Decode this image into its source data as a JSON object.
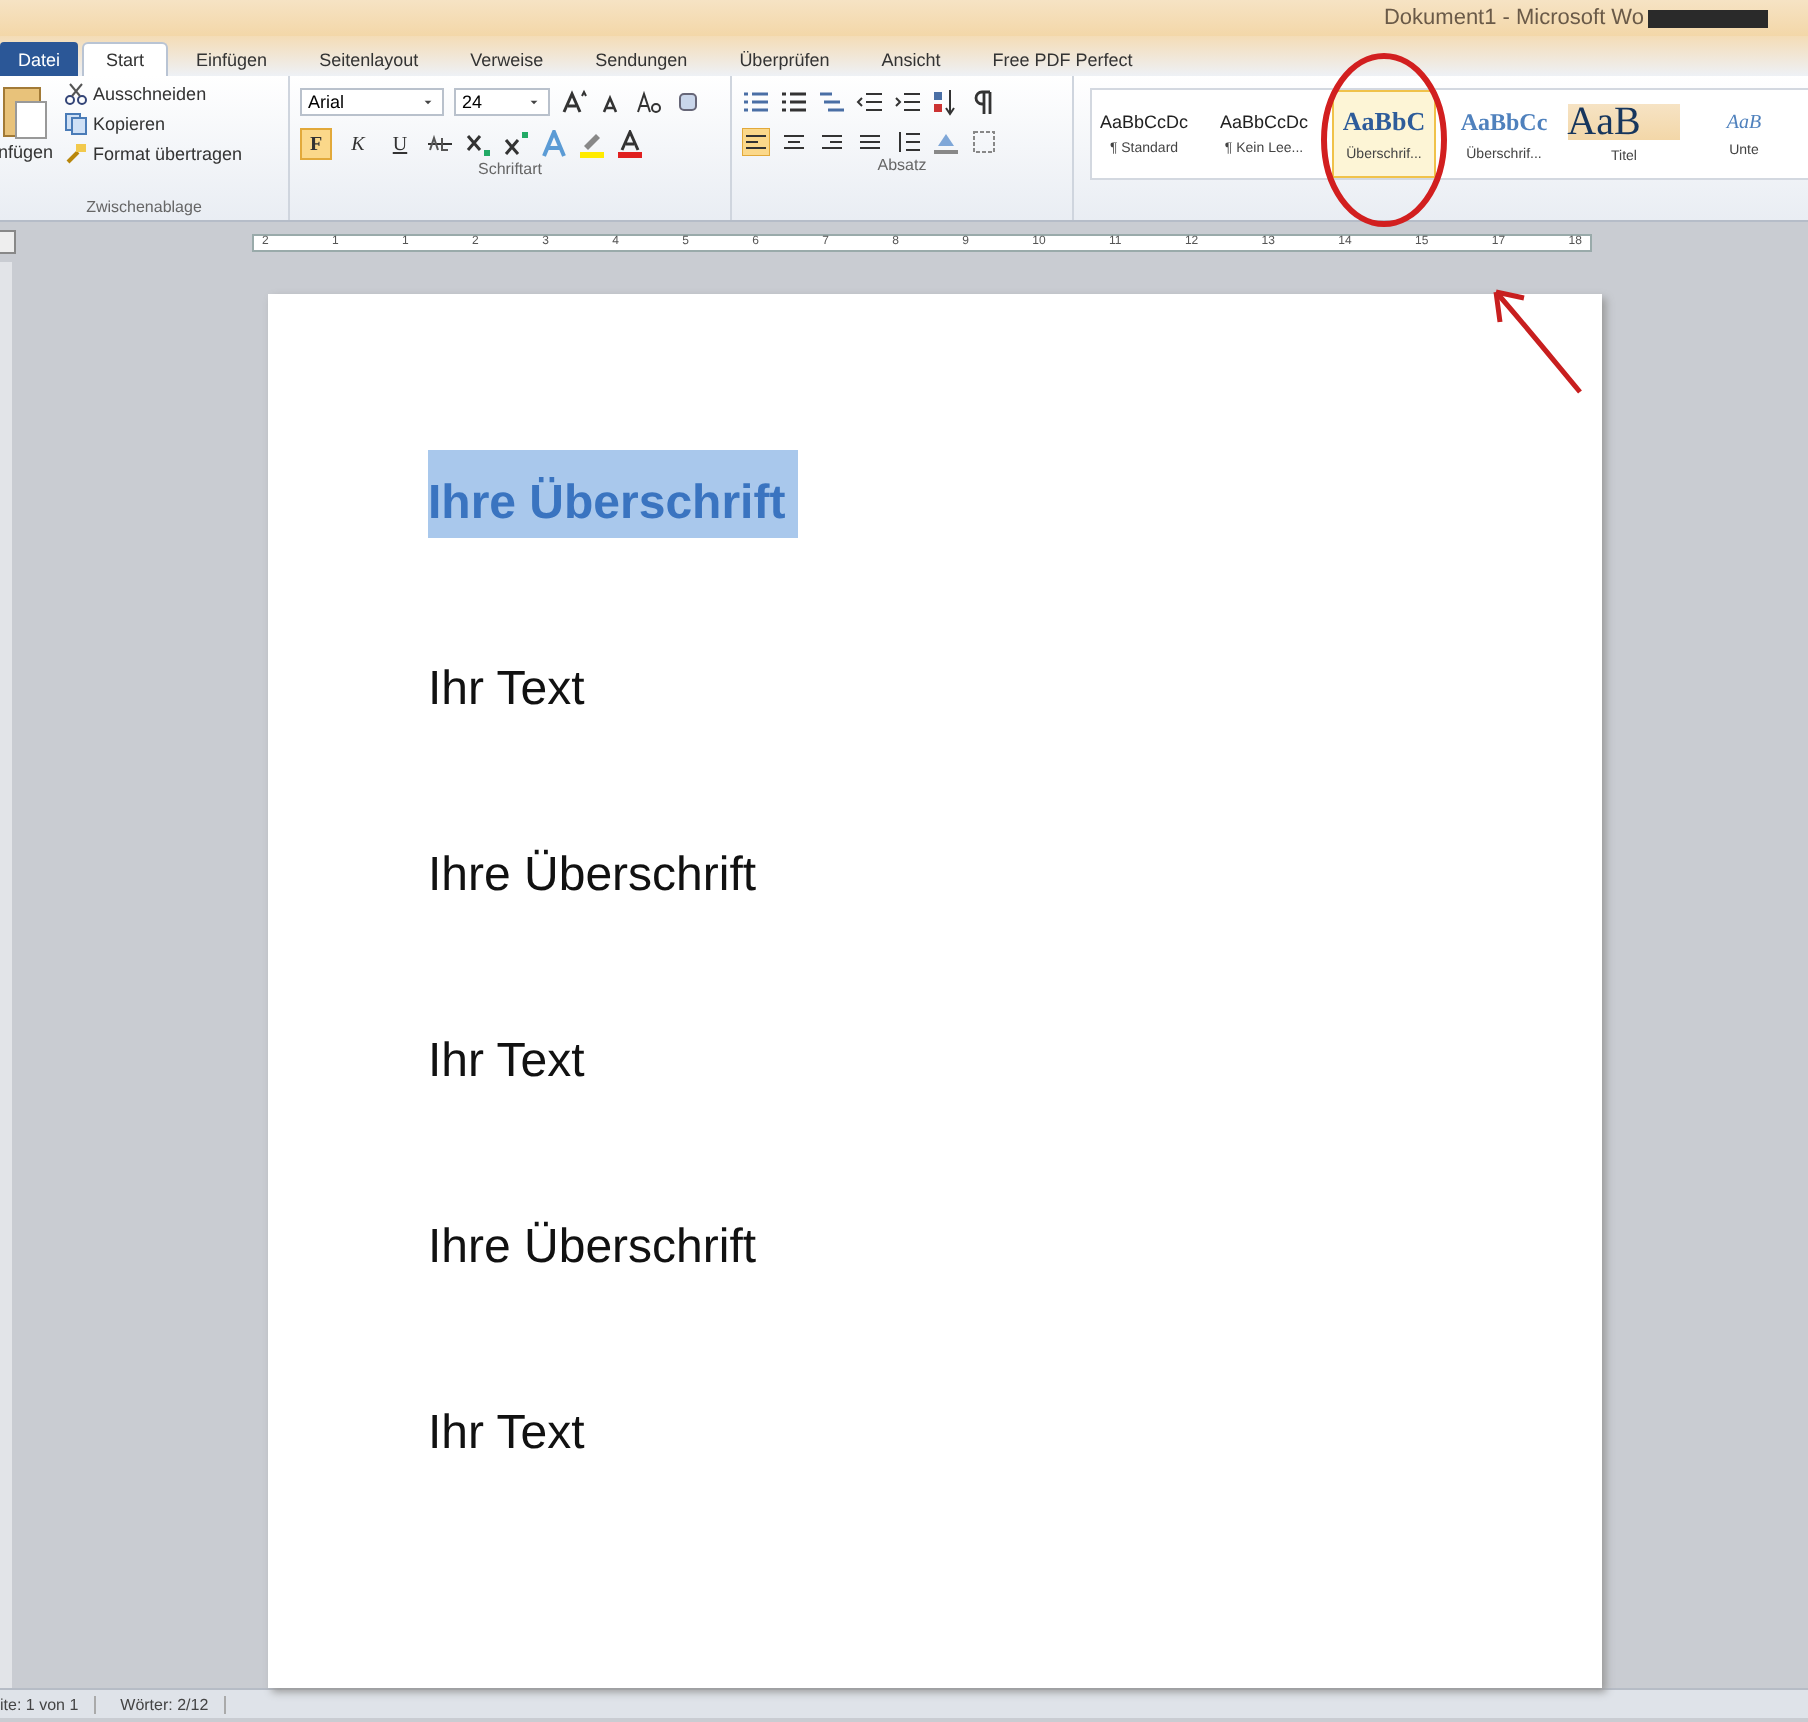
{
  "window": {
    "title": "Dokument1 - Microsoft Wo"
  },
  "tabs": [
    {
      "label": "Datei",
      "kind": "file",
      "selected": false
    },
    {
      "label": "Start",
      "kind": "tab",
      "selected": true
    },
    {
      "label": "Einfügen",
      "kind": "tab",
      "selected": false
    },
    {
      "label": "Seitenlayout",
      "kind": "tab",
      "selected": false
    },
    {
      "label": "Verweise",
      "kind": "tab",
      "selected": false
    },
    {
      "label": "Sendungen",
      "kind": "tab",
      "selected": false
    },
    {
      "label": "Überprüfen",
      "kind": "tab",
      "selected": false
    },
    {
      "label": "Ansicht",
      "kind": "tab",
      "selected": false
    },
    {
      "label": "Free PDF Perfect",
      "kind": "tab",
      "selected": false
    }
  ],
  "clipboard": {
    "paste_label": "nfügen",
    "items": [
      "Ausschneiden",
      "Kopieren",
      "Format übertragen"
    ],
    "group_label": "Zwischenablage"
  },
  "font": {
    "name": "Arial",
    "size": "24",
    "group_label": "Schriftart",
    "format_buttons": [
      {
        "label": "F",
        "kind": "bold",
        "selected": true
      },
      {
        "label": "K",
        "kind": "italic",
        "selected": false
      },
      {
        "label": "U",
        "kind": "underline",
        "selected": false
      }
    ]
  },
  "paragraph": {
    "group_label": "Absatz"
  },
  "styles": [
    {
      "preview": "AaBbCcDc",
      "name": "¶ Standard",
      "kind": "normal",
      "selected": false
    },
    {
      "preview": "AaBbCcDc",
      "name": "¶ Kein Lee...",
      "kind": "normal",
      "selected": false
    },
    {
      "preview": "AaBbC",
      "name": "Überschrif...",
      "kind": "heading1",
      "selected": true
    },
    {
      "preview": "AaBbCc",
      "name": "Überschrif...",
      "kind": "heading2",
      "selected": false
    },
    {
      "preview": "AaB",
      "name": "Titel",
      "kind": "title",
      "selected": false
    },
    {
      "preview": "AaB",
      "name": "Unte",
      "kind": "subtitle",
      "selected": false
    }
  ],
  "ruler_numbers": [
    "2",
    "1",
    "1",
    "2",
    "3",
    "4",
    "5",
    "6",
    "7",
    "8",
    "9",
    "10",
    "11",
    "12",
    "13",
    "14",
    "15",
    "17",
    "18"
  ],
  "document": [
    {
      "text": "Ihre Überschrift",
      "kind": "heading",
      "selected": true
    },
    {
      "text": "Ihr Text",
      "kind": "body",
      "selected": false
    },
    {
      "text": "Ihre Überschrift",
      "kind": "body",
      "selected": false
    },
    {
      "text": "Ihr Text",
      "kind": "body",
      "selected": false
    },
    {
      "text": "Ihre Überschrift",
      "kind": "body",
      "selected": false
    },
    {
      "text": "Ihr Text",
      "kind": "body",
      "selected": false
    }
  ],
  "status_bar": [
    "ite: 1 von 1",
    "Wörter: 2/12"
  ]
}
